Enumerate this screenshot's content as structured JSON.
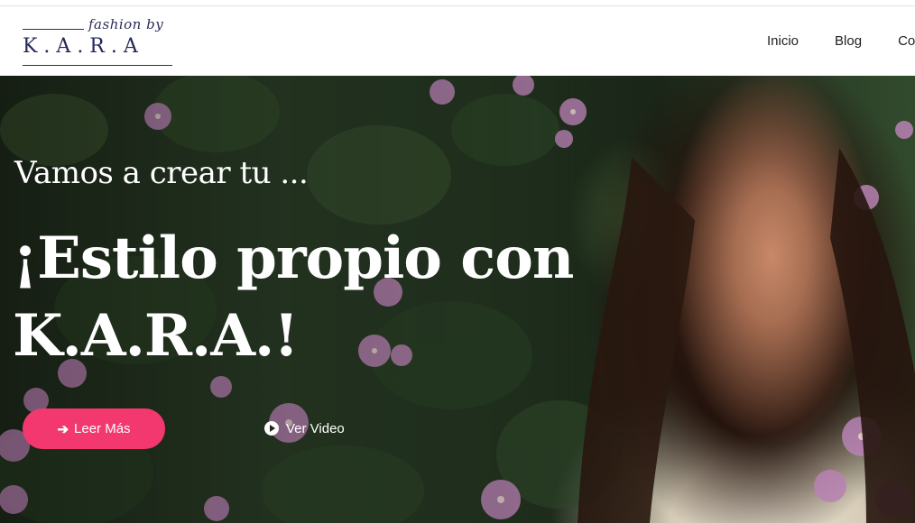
{
  "header": {
    "logo": {
      "script_text": "fashion by",
      "brand_text": "K.A.R.A"
    },
    "nav": [
      {
        "label": "Inicio"
      },
      {
        "label": "Blog"
      },
      {
        "label": "Contacto"
      }
    ]
  },
  "hero": {
    "subtitle": "Vamos a crear tu ...",
    "headline": "¡Estilo propio con K.A.R.A.!",
    "primary_button": {
      "label": "Leer Más",
      "icon": "arrow-right-icon"
    },
    "secondary_button": {
      "label": "Ver Video",
      "icon": "play-circle-icon"
    }
  },
  "colors": {
    "accent": "#f2386e",
    "brand_navy": "#23275a"
  }
}
